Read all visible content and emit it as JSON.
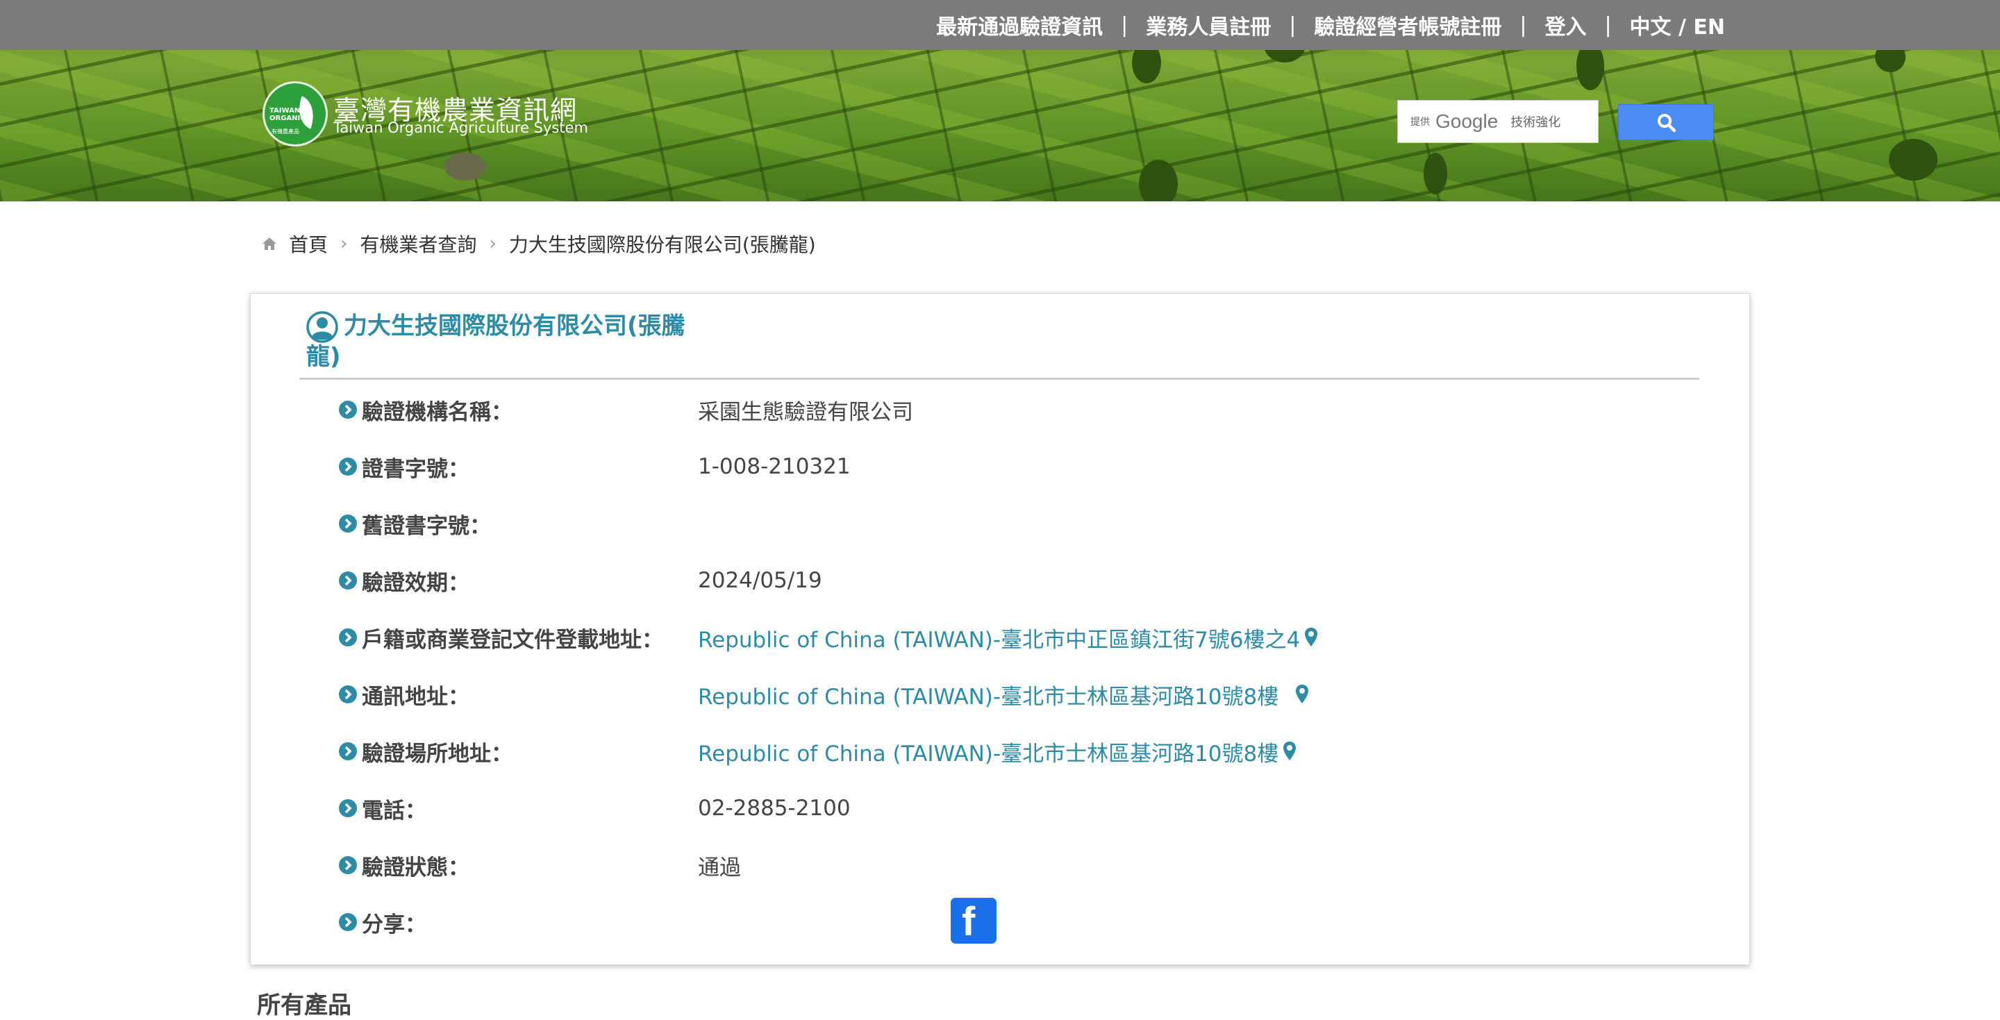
{
  "topnav": {
    "items": [
      {
        "label": "最新通過驗證資訊"
      },
      {
        "label": "業務人員註冊"
      },
      {
        "label": "驗證經營者帳號註冊"
      },
      {
        "label": "登入"
      },
      {
        "label": "中文 / EN"
      }
    ]
  },
  "site": {
    "title": "臺灣有機農業資訊網",
    "subtitle": "Taiwan Organic Agriculture System",
    "logo_text_1": "TAIWAN",
    "logo_text_2": "ORGANIC",
    "logo_text_3": "有機農產品"
  },
  "search": {
    "prefix": "提供",
    "brand": "Google",
    "suffix": "技術強化",
    "button_icon": "search-icon"
  },
  "breadcrumb": {
    "home_icon": "home-icon",
    "items": [
      {
        "label": "首頁"
      },
      {
        "label": "有機業者查詢"
      },
      {
        "label": "力大生技國際股份有限公司(張騰龍)"
      }
    ]
  },
  "card": {
    "title_icon": "user-circle-icon",
    "title": "力大生技國際股份有限公司(張騰龍)",
    "rows": [
      {
        "label": "驗證機構名稱：",
        "value": "采園生態驗證有限公司"
      },
      {
        "label": "證書字號：",
        "value": "1-008-210321"
      },
      {
        "label": "舊證書字號：",
        "value": ""
      },
      {
        "label": "驗證效期：",
        "value": "2024/05/19"
      },
      {
        "label": "戶籍或商業登記文件登載地址：",
        "value": "Republic of China (TAIWAN)-臺北市中正區鎮江街7號6樓之4"
      },
      {
        "label": "通訊地址：",
        "value": "Republic of China (TAIWAN)-臺北市士林區基河路10號8樓 "
      },
      {
        "label": "驗證場所地址：",
        "value": "Republic of China (TAIWAN)-臺北市士林區基河路10號8樓"
      },
      {
        "label": "電話：",
        "value": "02-2885-2100"
      },
      {
        "label": "驗證狀態：",
        "value": "通過"
      },
      {
        "label": "分享：",
        "value": ""
      }
    ],
    "share_icon": "facebook-icon",
    "share_glyph": "f"
  },
  "below": {
    "title": "所有產品"
  },
  "colors": {
    "topbar": "#7b7b7b",
    "accent": "#2e8ba6",
    "facebook": "#1a6fea",
    "search_button": "#4d8bf5"
  }
}
